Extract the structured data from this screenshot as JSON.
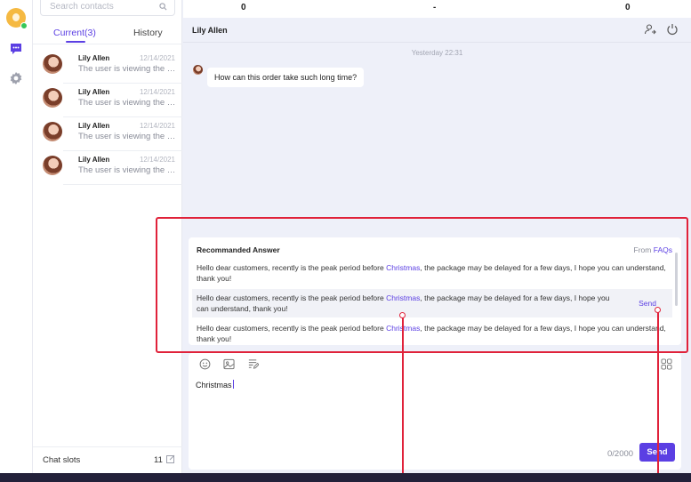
{
  "colors": {
    "accent": "#5b3fe3",
    "callout": "#e0223a",
    "online": "#35c759"
  },
  "search": {
    "placeholder": "Search contacts"
  },
  "tabs": {
    "current": "Current(3)",
    "history": "History"
  },
  "conversations": [
    {
      "name": "Lily Allen",
      "date": "12/14/2021",
      "preview": "The user is viewing the product page"
    },
    {
      "name": "Lily Allen",
      "date": "12/14/2021",
      "preview": "The user is viewing the product page"
    },
    {
      "name": "Lily Allen",
      "date": "12/14/2021",
      "preview": "The user is viewing the product page"
    },
    {
      "name": "Lily Allen",
      "date": "12/14/2021",
      "preview": "The user is viewing the product page"
    }
  ],
  "chat_slots": {
    "label": "Chat slots",
    "count": "11"
  },
  "stats": {
    "values": [
      "0",
      "-",
      "0"
    ]
  },
  "chat": {
    "title": "Lily Allen",
    "timestamp": "Yesterday 22:31",
    "message": "How can this order take such long time?"
  },
  "recommended": {
    "title": "Recommanded Answer",
    "source_prefix": "From ",
    "source": "FAQs",
    "keyword": "Christmas",
    "answer_before": "Hello dear customers, recently is the peak period before ",
    "answer_after": ", the package may be delayed for a few days, I hope you can understand, thank you!",
    "send_label": "Send"
  },
  "composer": {
    "draft": "Christmas",
    "counter": "0/2000",
    "send_label": "Send"
  }
}
